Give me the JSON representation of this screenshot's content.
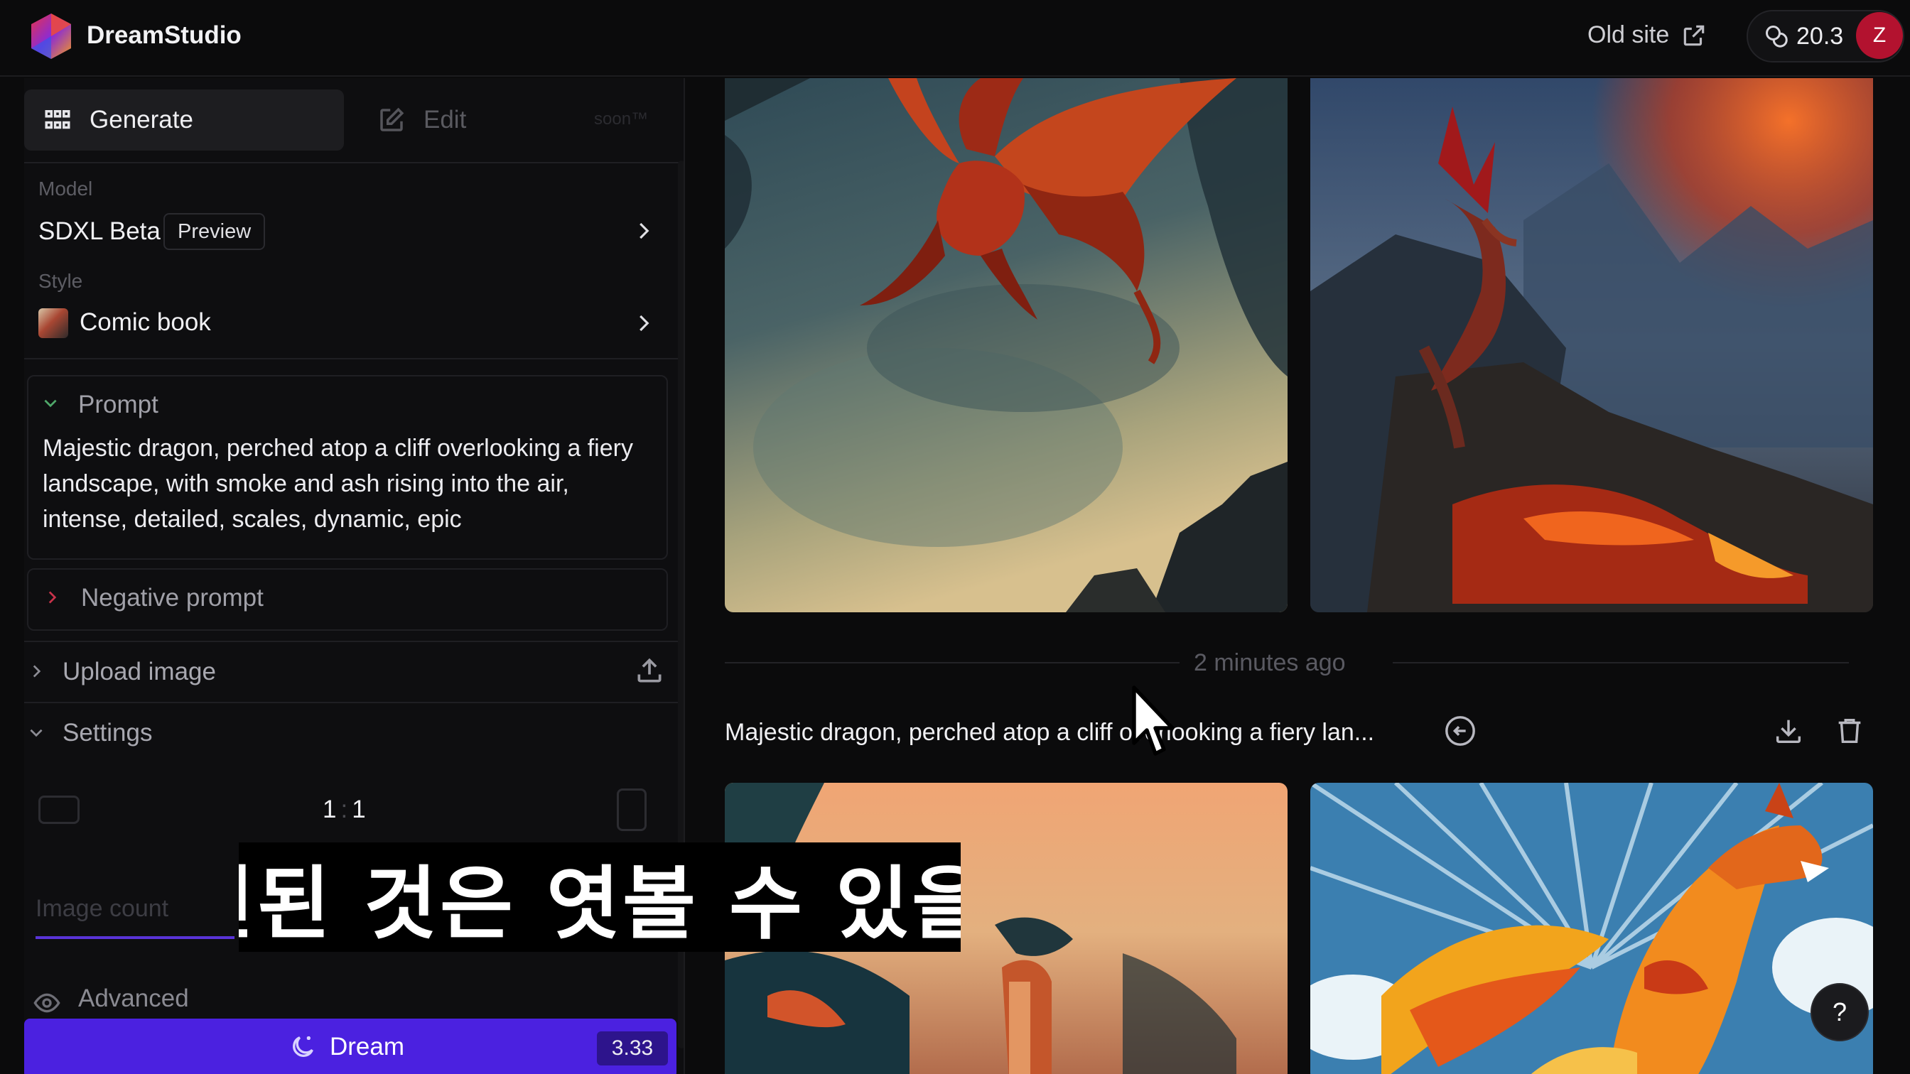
{
  "app": {
    "brand": "DreamStudio"
  },
  "header": {
    "old_site_label": "Old site",
    "credits": "20.3",
    "avatar_initial": "Z"
  },
  "sidebar": {
    "tabs": {
      "generate": "Generate",
      "edit": "Edit",
      "soon": "soon™"
    },
    "model": {
      "label": "Model",
      "value": "SDXL Beta",
      "badge": "Preview"
    },
    "style": {
      "label": "Style",
      "value": "Comic book"
    },
    "prompt": {
      "label": "Prompt",
      "text": "Majestic dragon, perched atop a cliff overlooking a fiery landscape, with smoke and ash rising into the air, intense, detailed, scales, dynamic, epic"
    },
    "negative_prompt": {
      "label": "Negative prompt"
    },
    "upload_image": {
      "label": "Upload image"
    },
    "settings": {
      "label": "Settings",
      "ratio_left": "1",
      "ratio_sep": ":",
      "ratio_right": "1"
    },
    "image_count": {
      "label": "Image count"
    },
    "advanced": {
      "label": "Advanced"
    },
    "dream_button": {
      "label": "Dream",
      "cost": "3.33"
    }
  },
  "main": {
    "timestamp": "2 minutes ago",
    "generation_title": "Majestic dragon, perched atop a cliff overlooking a fiery lan...",
    "subtitle": "그래도 개선된 것은 엿볼 수 있을 것 같고요"
  },
  "help": {
    "label": "?"
  },
  "colors": {
    "accent": "#4b21e0",
    "avatar": "#b3122f",
    "background": "#0b0b0c"
  }
}
